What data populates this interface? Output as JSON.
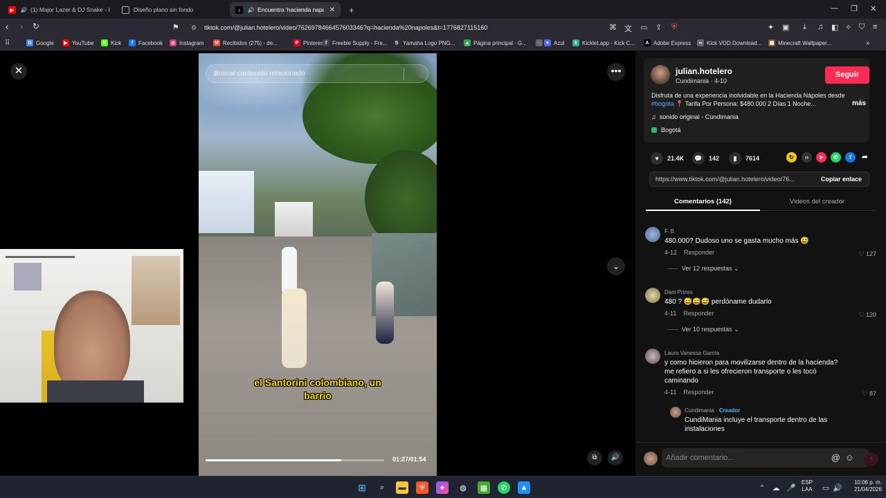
{
  "tabs": [
    {
      "label": "(1) Major Lazer & DJ Snake - Lea",
      "icon": "youtube-icon"
    },
    {
      "label": "Diseño plano sin fondo",
      "icon": "page-icon"
    },
    {
      "label": "Encuentra 'hacienda napoles'",
      "icon": "tiktok-icon"
    }
  ],
  "toolbar": {
    "url": "tiktok.com/@julian.hotelero/video/7626978466457603346?q=hacienda%20napoles&t=1776827115160"
  },
  "bookmarks": [
    {
      "label": "Google",
      "color": "#4285f4",
      "glyph": "G"
    },
    {
      "label": "YouTube",
      "color": "#ff0000",
      "glyph": "▶"
    },
    {
      "label": "Kick",
      "color": "#53fc18",
      "glyph": "K"
    },
    {
      "label": "Facebook",
      "color": "#1877f2",
      "glyph": "f"
    },
    {
      "label": "Instagram",
      "color": "#e1306c",
      "glyph": "◎"
    },
    {
      "label": "Recibidos (275) - de...",
      "color": "#ea4335",
      "glyph": "M"
    },
    {
      "label": "Pinterest",
      "color": "#e60023",
      "glyph": "P"
    },
    {
      "label": "Freebie Supply - Fre...",
      "color": "#444",
      "glyph": "f"
    },
    {
      "label": "Yamaha Logo PNG...",
      "color": "#333",
      "glyph": "S"
    },
    {
      "label": "Página principal - G...",
      "color": "#34a853",
      "glyph": "▲"
    },
    {
      "label": "",
      "color": "#666",
      "glyph": "◌"
    },
    {
      "label": "Azul",
      "color": "#4a6cf7",
      "glyph": "♥"
    },
    {
      "label": "Kicklet.app - Kick C...",
      "color": "#3a8",
      "glyph": "k"
    },
    {
      "label": "Adobe Express",
      "color": "#000",
      "glyph": "A"
    },
    {
      "label": "Kick VOD Download...",
      "color": "#666",
      "glyph": "∞"
    },
    {
      "label": "Minecraft Wallpaper...",
      "color": "#8b5a2b",
      "glyph": "▦"
    }
  ],
  "video": {
    "search_placeholder": "Buscar contenido relacionado",
    "caption_line1": "el Santorini colombiano, un",
    "caption_line2": "barrio",
    "timecode": "01:27/01:54",
    "progress": 0.76
  },
  "creator": {
    "username": "julian.hotelero",
    "subline": "Cundimania · 4-10",
    "follow_label": "Seguir",
    "desc_pre": "Disfruta de una experiencia inolvidable en la Hacienda Nápoles desde ",
    "desc_tag": "#bogota",
    "desc_post": " 📍 Tarifa Por Persona: $480.000 2 Días 1 Noche...",
    "more_label": "más",
    "music": "sonido original - Cundimania",
    "location": "Bogotá"
  },
  "stats": {
    "likes": "21.4K",
    "comments": "142",
    "saves": "7614"
  },
  "share": {
    "link": "https://www.tiktok.com/@julian.hotelero/video/76...",
    "copy_label": "Copiar enlace"
  },
  "panel_tabs": {
    "comments": "Comentarios (142)",
    "creator_videos": "Videos del creador"
  },
  "comments": [
    {
      "name": "F. B.",
      "text": "480.000? Dudoso uno se gasta mucho más 😅",
      "date": "4-12",
      "reply": "Responder",
      "likes": "127",
      "replies": "Ver 12 respuestas"
    },
    {
      "name": "Dani Prinss",
      "text": "480 ? 😅😅😅 perdóname dudarlo",
      "date": "4-11",
      "reply": "Responder",
      "likes": "120",
      "replies": "Ver 10 respuestas"
    },
    {
      "name": "Laura Vanessa Garcia",
      "text": "y como hicieron para movilizarse dentro de la hacienda? me refiero a si les ofrecieron transporte o les tocó caminando",
      "date": "4-11",
      "reply": "Responder",
      "likes": "87"
    },
    {
      "name": "Cundimania",
      "creator_tag": "Creador",
      "text": "CundiMania incluye el transporte dentro de las instalaciones"
    }
  ],
  "composer": {
    "placeholder": "Añadir comentario..."
  },
  "tray": {
    "lang1": "ESP",
    "lang2": "LAA",
    "time": "10:06 p. m.",
    "date": "21/04/2026"
  }
}
